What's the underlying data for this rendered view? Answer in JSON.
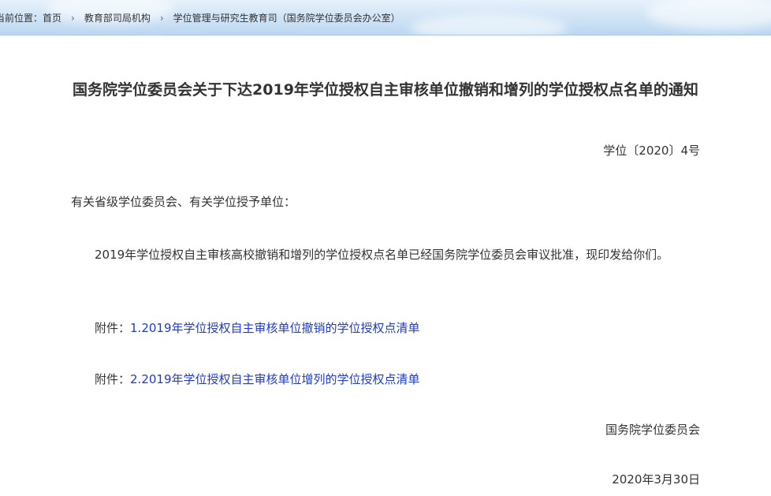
{
  "breadcrumb": {
    "label": "当前位置：",
    "items": [
      "首页",
      "教育部司局机构",
      "学位管理与研究生教育司（国务院学位委员会办公室）"
    ],
    "separator": "›"
  },
  "document": {
    "title": "国务院学位委员会关于下达2019年学位授权自主审核单位撤销和增列的学位授权点名单的通知",
    "number": "学位〔2020〕4号",
    "salutation": "有关省级学位委员会、有关学位授予单位：",
    "body": "2019年学位授权自主审核高校撤销和增列的学位授权点名单已经国务院学位委员会审议批准，现印发给你们。",
    "attachments": [
      {
        "prefix": "附件：",
        "link_text": "1.2019年学位授权自主审核单位撤销的学位授权点清单"
      },
      {
        "prefix": "附件：",
        "link_text": "2.2019年学位授权自主审核单位增列的学位授权点清单"
      }
    ],
    "signature": "国务院学位委员会",
    "date": "2020年3月30日"
  },
  "colors": {
    "link": "#1f3bc8",
    "text": "#333333",
    "header_bg": "#cfe3f6"
  }
}
